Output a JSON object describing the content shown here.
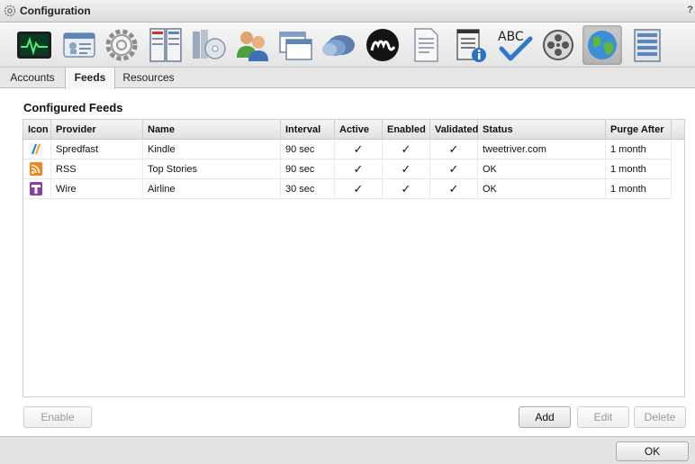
{
  "window": {
    "title": "Configuration",
    "help": "?"
  },
  "toolbar": {
    "icons": [
      "monitor-icon",
      "id-card-icon",
      "settings-gear-icon",
      "server-icon",
      "media-library-icon",
      "users-icon",
      "windows-icon",
      "cloud-icon",
      "signature-logo-icon",
      "document-icon",
      "notepad-info-icon",
      "spell-check-icon",
      "film-reel-icon",
      "globe-icon",
      "storage-icon"
    ],
    "selected": "globe-icon"
  },
  "tabs": [
    {
      "label": "Accounts"
    },
    {
      "label": "Feeds",
      "selected": true
    },
    {
      "label": "Resources"
    }
  ],
  "section": {
    "title": "Configured Feeds"
  },
  "table": {
    "headers": [
      "Icon",
      "Provider",
      "Name",
      "Interval",
      "Active",
      "Enabled",
      "Validated",
      "Status",
      "Purge After"
    ],
    "rows": [
      {
        "icon": "spredfast-icon",
        "provider": "Spredfast",
        "name": "Kindle",
        "interval": "90 sec",
        "active": "✓",
        "enabled": "✓",
        "validated": "✓",
        "status": "tweetriver.com",
        "purge": "1 month"
      },
      {
        "icon": "rss-icon",
        "provider": "RSS",
        "name": "Top Stories",
        "interval": "90 sec",
        "active": "✓",
        "enabled": "✓",
        "validated": "✓",
        "status": "OK",
        "purge": "1 month"
      },
      {
        "icon": "wire-icon",
        "provider": "Wire",
        "name": "Airline",
        "interval": "30 sec",
        "active": "✓",
        "enabled": "✓",
        "validated": "✓",
        "status": "OK",
        "purge": "1 month"
      }
    ]
  },
  "buttons": {
    "enable": "Enable",
    "add": "Add",
    "edit": "Edit",
    "delete": "Delete",
    "ok": "OK"
  },
  "colors": {
    "rss": "#f4841c",
    "spredfast": "#1c7fc4",
    "wire": "#8a3fa0",
    "selected_tool": "#bdbdbd"
  }
}
